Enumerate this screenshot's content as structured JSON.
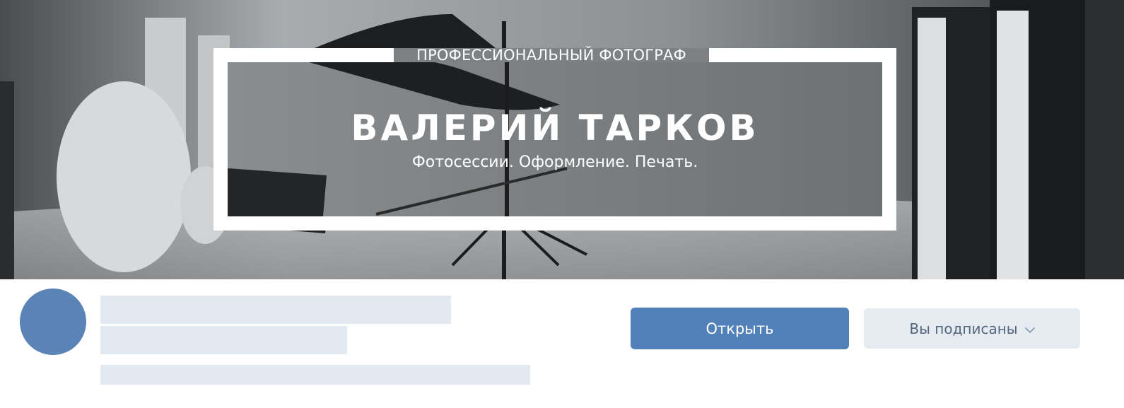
{
  "cover": {
    "kicker": "ПРОФЕССИОНАЛЬНЫЙ ФОТОГРАФ",
    "title": "ВАЛЕРИЙ ТАРКОВ",
    "subtitle": "Фотосессии. Оформление. Печать."
  },
  "actions": {
    "open_label": "Открыть",
    "subscribed_label": "Вы подписаны",
    "subscribed_icon": "chevron-down-icon"
  },
  "colors": {
    "avatar": "#5a84b5",
    "primary_button": "#5181b8",
    "secondary_button": "#e5ebf1",
    "skeleton": "#e2e9f1"
  }
}
